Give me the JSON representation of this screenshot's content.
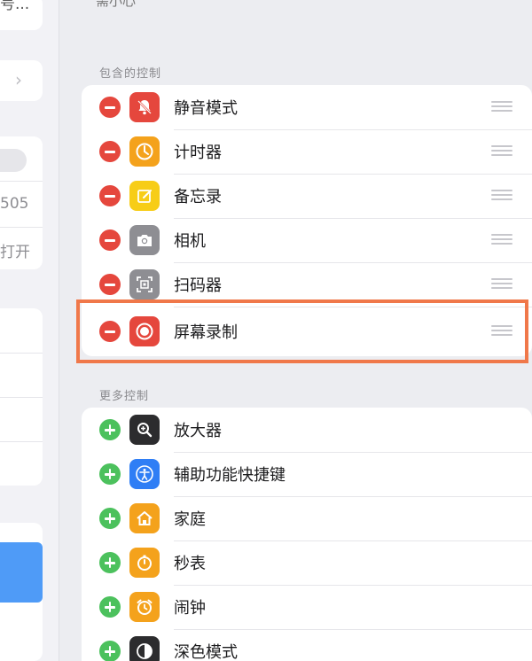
{
  "left_panel": {
    "row1_text": "号...",
    "row_value": "505",
    "row_open": "打开"
  },
  "top_cut_text": "需小心",
  "included_section": {
    "title": "包含的控制",
    "items": [
      {
        "label": "静音模式",
        "icon": "bell-slash-icon",
        "color": "#e5473d"
      },
      {
        "label": "计时器",
        "icon": "timer-icon",
        "color": "#f4a21c"
      },
      {
        "label": "备忘录",
        "icon": "note-icon",
        "color": "#f7cd17"
      },
      {
        "label": "相机",
        "icon": "camera-icon",
        "color": "#8e8e93"
      },
      {
        "label": "扫码器",
        "icon": "qr-scan-icon",
        "color": "#8e8e93"
      },
      {
        "label": "屏幕录制",
        "icon": "record-icon",
        "color": "#e5473d"
      }
    ]
  },
  "more_section": {
    "title": "更多控制",
    "items": [
      {
        "label": "放大器",
        "icon": "magnifier-icon",
        "color": "#2c2c2e"
      },
      {
        "label": "辅助功能快捷键",
        "icon": "accessibility-icon",
        "color": "#2f7ef5"
      },
      {
        "label": "家庭",
        "icon": "home-icon",
        "color": "#f4a21c"
      },
      {
        "label": "秒表",
        "icon": "stopwatch-icon",
        "color": "#f4a21c"
      },
      {
        "label": "闹钟",
        "icon": "alarm-icon",
        "color": "#f4a21c"
      },
      {
        "label": "深色模式",
        "icon": "dark-mode-icon",
        "color": "#2c2c2e"
      }
    ]
  },
  "highlight_color": "#f0784a"
}
